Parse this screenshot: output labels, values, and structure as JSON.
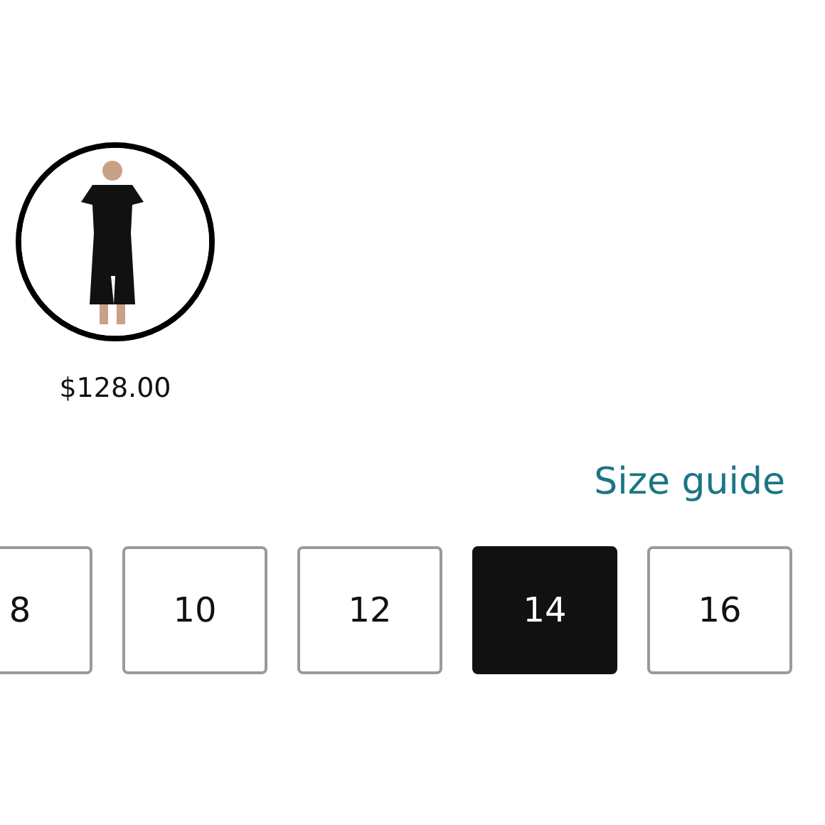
{
  "swatches": [
    {
      "kind": "picture",
      "price": "$128.00",
      "selected": true
    }
  ],
  "size_guide": "Size guide",
  "sizes": [
    {
      "label": "8",
      "selected": false
    },
    {
      "label": "10",
      "selected": false
    },
    {
      "label": "12",
      "selected": false
    },
    {
      "label": "14",
      "selected": true
    },
    {
      "label": "16",
      "selected": false
    }
  ]
}
